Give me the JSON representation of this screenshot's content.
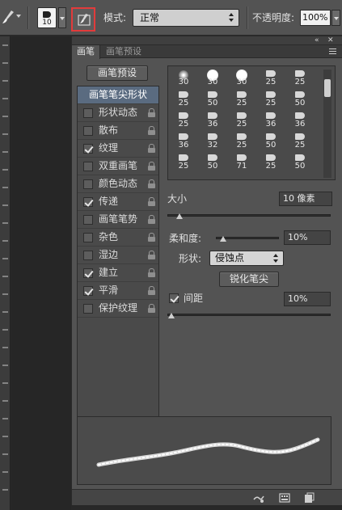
{
  "options_bar": {
    "tool_icon": "brush-icon",
    "brush_size": "10",
    "panel_toggle_icon": "brush-panel-toggle-icon",
    "mode_label": "模式:",
    "mode_value": "正常",
    "opacity_label": "不透明度:",
    "opacity_value": "100%",
    "highlight_color": "#e23b3b"
  },
  "panel": {
    "collapse": "«",
    "close": "✕",
    "tabs": [
      {
        "label": "画笔",
        "active": true
      },
      {
        "label": "画笔预设",
        "active": false
      }
    ],
    "preset_button": "画笔预设",
    "options": [
      {
        "label": "画笔笔尖形状",
        "header": true
      },
      {
        "label": "形状动态",
        "checked": false
      },
      {
        "label": "散布",
        "checked": false
      },
      {
        "label": "纹理",
        "checked": true
      },
      {
        "label": "双重画笔",
        "checked": false
      },
      {
        "label": "颜色动态",
        "checked": false
      },
      {
        "label": "传递",
        "checked": true
      },
      {
        "label": "画笔笔势",
        "checked": false
      },
      {
        "label": "杂色",
        "checked": false
      },
      {
        "label": "湿边",
        "checked": false
      },
      {
        "label": "建立",
        "checked": true
      },
      {
        "label": "平滑",
        "checked": true
      },
      {
        "label": "保护纹理",
        "checked": false
      }
    ],
    "tips": [
      {
        "size": "30",
        "icon": "soft"
      },
      {
        "size": "30",
        "icon": "round"
      },
      {
        "size": "30",
        "icon": "round"
      },
      {
        "size": "25",
        "icon": "tip"
      },
      {
        "size": "25",
        "icon": "tip"
      },
      {
        "size": "25",
        "icon": "tip"
      },
      {
        "size": "50",
        "icon": "tip"
      },
      {
        "size": "25",
        "icon": "tip"
      },
      {
        "size": "25",
        "icon": "tip"
      },
      {
        "size": "50",
        "icon": "tip"
      },
      {
        "size": "25",
        "icon": "tip"
      },
      {
        "size": "36",
        "icon": "tip"
      },
      {
        "size": "25",
        "icon": "tip"
      },
      {
        "size": "36",
        "icon": "tip"
      },
      {
        "size": "36",
        "icon": "tip"
      },
      {
        "size": "36",
        "icon": "tip"
      },
      {
        "size": "32",
        "icon": "tip"
      },
      {
        "size": "25",
        "icon": "tip"
      },
      {
        "size": "50",
        "icon": "tip"
      },
      {
        "size": "25",
        "icon": "tip"
      },
      {
        "size": "25",
        "icon": "tip"
      },
      {
        "size": "50",
        "icon": "tip"
      },
      {
        "size": "71",
        "icon": "tip"
      },
      {
        "size": "25",
        "icon": "tip"
      },
      {
        "size": "50",
        "icon": "tip"
      }
    ],
    "size_label": "大小",
    "size_value": "10 像素",
    "size_slider": 0.07,
    "hardness_label": "柔和度:",
    "hardness_value": "10%",
    "hardness_slider": 0.1,
    "shape_label": "形状:",
    "shape_value": "侵蚀点",
    "sharpen_button": "锐化笔尖",
    "spacing_label": "间距",
    "spacing_value": "10%",
    "spacing_slider": 0.02,
    "bottom_icons": [
      "toggle-preview-icon",
      "grid-icon",
      "new-preset-icon"
    ]
  }
}
